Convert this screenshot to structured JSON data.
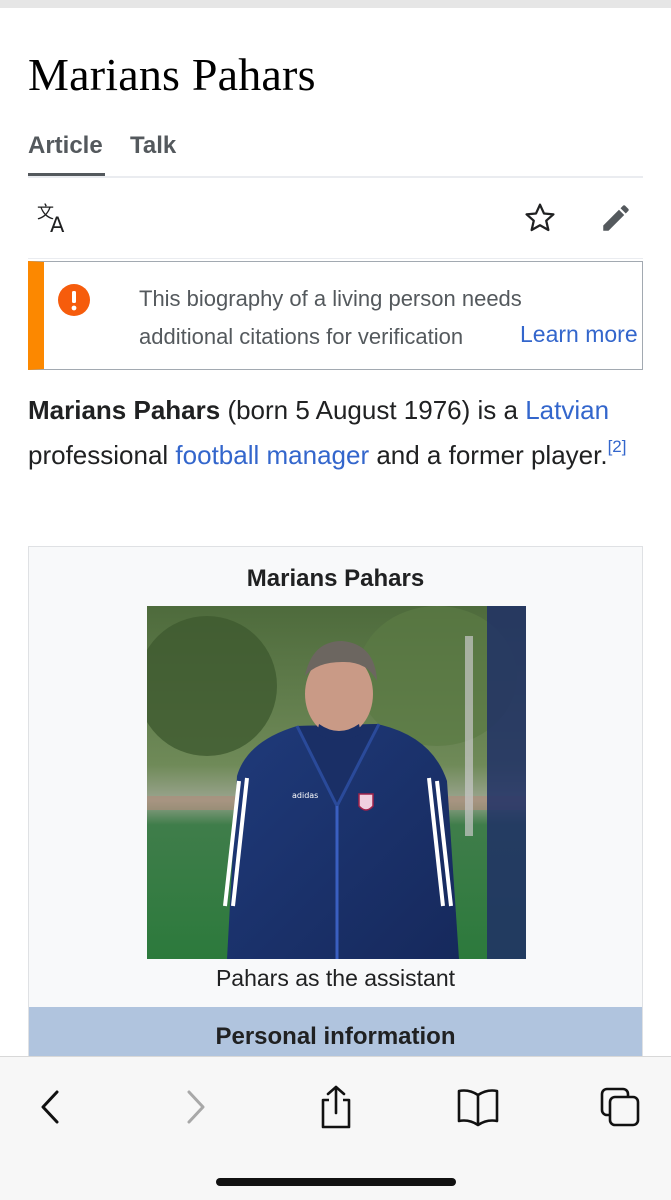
{
  "page": {
    "title": "Marians Pahars",
    "tabs": [
      {
        "label": "Article"
      },
      {
        "label": "Talk"
      }
    ]
  },
  "toolbar": {
    "language_icon": "translate-icon",
    "watch_icon": "star-icon",
    "edit_icon": "pencil-icon"
  },
  "notice": {
    "line1": "This biography of a living person needs",
    "line2": "additional citations for verification",
    "link": "Learn more",
    "accent_color": "#fc8800",
    "icon": "exclamation-icon"
  },
  "lead": {
    "name": "Marians Pahars",
    "text1": " (born 5 August 1976) is a",
    "link1": "Latvian",
    "text2": " professional ",
    "link2": "football manager",
    "text3": " and a former player.",
    "ref": "[2]"
  },
  "infobox": {
    "title": "Marians Pahars",
    "caption": "Pahars as the assistant",
    "section_header": "Personal information",
    "header_color": "#b0c4de"
  },
  "browser": {
    "back_icon": "chevron-left-icon",
    "forward_icon": "chevron-right-icon",
    "share_icon": "share-icon",
    "bookmarks_icon": "book-icon",
    "tabs_icon": "tabs-icon"
  }
}
